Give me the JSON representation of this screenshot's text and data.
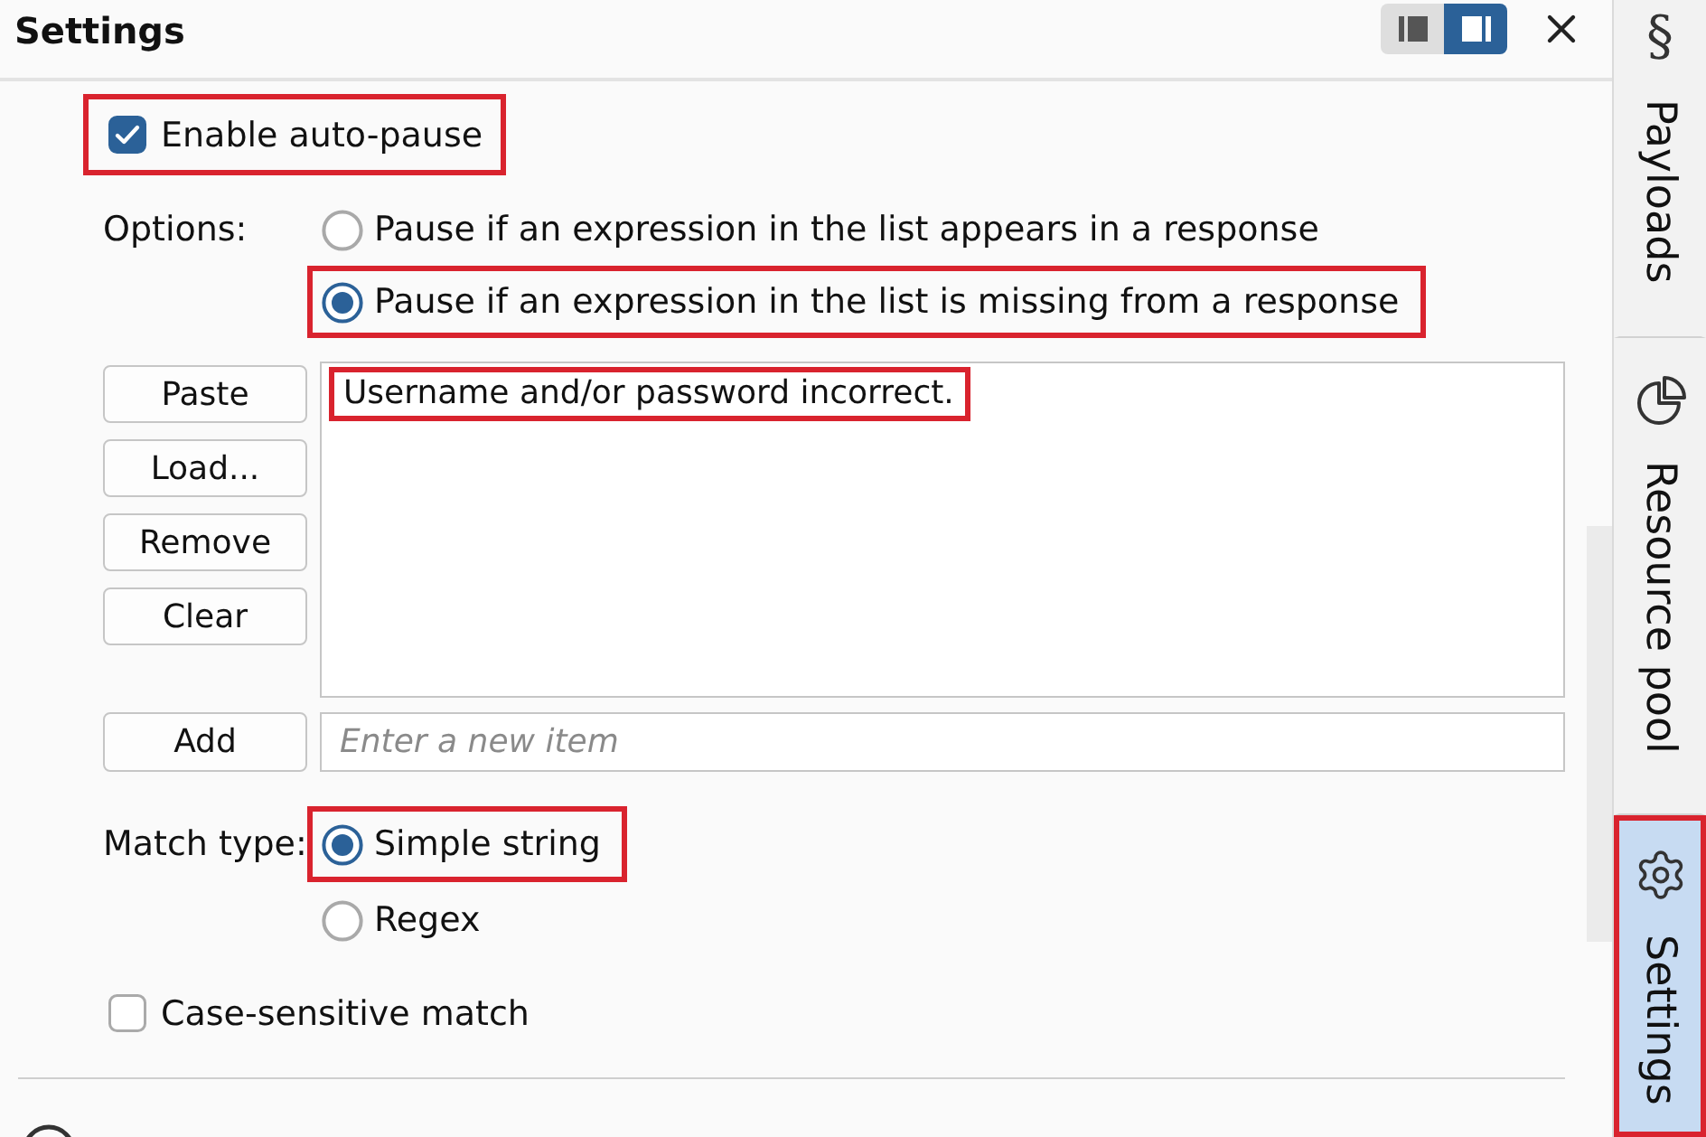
{
  "header": {
    "title": "Settings",
    "layout_buttons": [
      {
        "selected": false
      },
      {
        "selected": true
      }
    ]
  },
  "auto_pause": {
    "label": "Enable auto-pause",
    "checked": true,
    "highlighted": true
  },
  "options": {
    "label": "Options:",
    "choices": [
      {
        "label": "Pause if an expression in the list appears in a response",
        "selected": false,
        "highlighted": false
      },
      {
        "label": "Pause if an expression in the list is missing from a response",
        "selected": true,
        "highlighted": true
      }
    ]
  },
  "list": {
    "buttons": [
      "Paste",
      "Load...",
      "Remove",
      "Clear"
    ],
    "items": [
      {
        "text": "Username and/or password incorrect.",
        "highlighted": true
      }
    ]
  },
  "add": {
    "button": "Add",
    "placeholder": "Enter a new item"
  },
  "match_type": {
    "label": "Match type:",
    "choices": [
      {
        "label": "Simple string",
        "selected": true,
        "highlighted": true
      },
      {
        "label": "Regex",
        "selected": false,
        "highlighted": false
      }
    ]
  },
  "case_sensitive": {
    "label": "Case-sensitive match",
    "checked": false,
    "highlighted": false
  },
  "sidebar": {
    "tabs": [
      {
        "kind": "glyph",
        "icon": "§",
        "label": "Payloads",
        "selected": false,
        "highlighted": false
      },
      {
        "kind": "pie",
        "label": "Resource pool",
        "selected": false,
        "highlighted": false
      },
      {
        "kind": "gear",
        "label": "Settings",
        "selected": true,
        "highlighted": true
      }
    ]
  }
}
